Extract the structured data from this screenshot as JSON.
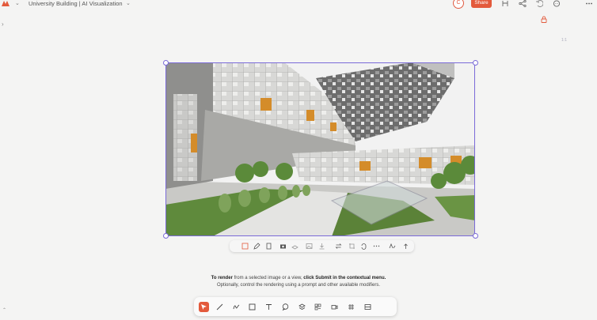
{
  "header": {
    "title": "University Building | AI Visualization",
    "avatar_initial": "C",
    "share_label": "Share",
    "icons": [
      "logo-icon",
      "chevron-down-icon",
      "compare-icon",
      "share-network-icon",
      "undo-icon",
      "comment-icon",
      "more-icon"
    ]
  },
  "canvas": {
    "zoom_label": "1:1",
    "image_subject": "Modern university building courtyard with cantilevered patterned facade",
    "colors": {
      "selection": "#7a6ad8",
      "accent": "#e35a3c",
      "facade_orange": "#d48c2a",
      "lawn": "#5f8a3c"
    }
  },
  "context_menu": {
    "items": [
      "render-icon",
      "edit-icon",
      "info-icon",
      "camera-icon",
      "layers-icon",
      "image-icon",
      "download-icon",
      "replace-icon",
      "crop-icon",
      "loop-icon",
      "more-icon",
      "text-style-icon",
      "upload-icon"
    ]
  },
  "hint": {
    "line1_a": "To render",
    "line1_b": " from a selected image or a view, ",
    "line1_c": "click Submit in the contextual menu.",
    "line2": "Optionally, control the rendering using a prompt and other available modifiers."
  },
  "toolbar": {
    "tools": [
      "select",
      "line",
      "freehand",
      "rectangle",
      "text",
      "comment",
      "layer",
      "component",
      "video",
      "grid",
      "section"
    ],
    "active": "select"
  }
}
